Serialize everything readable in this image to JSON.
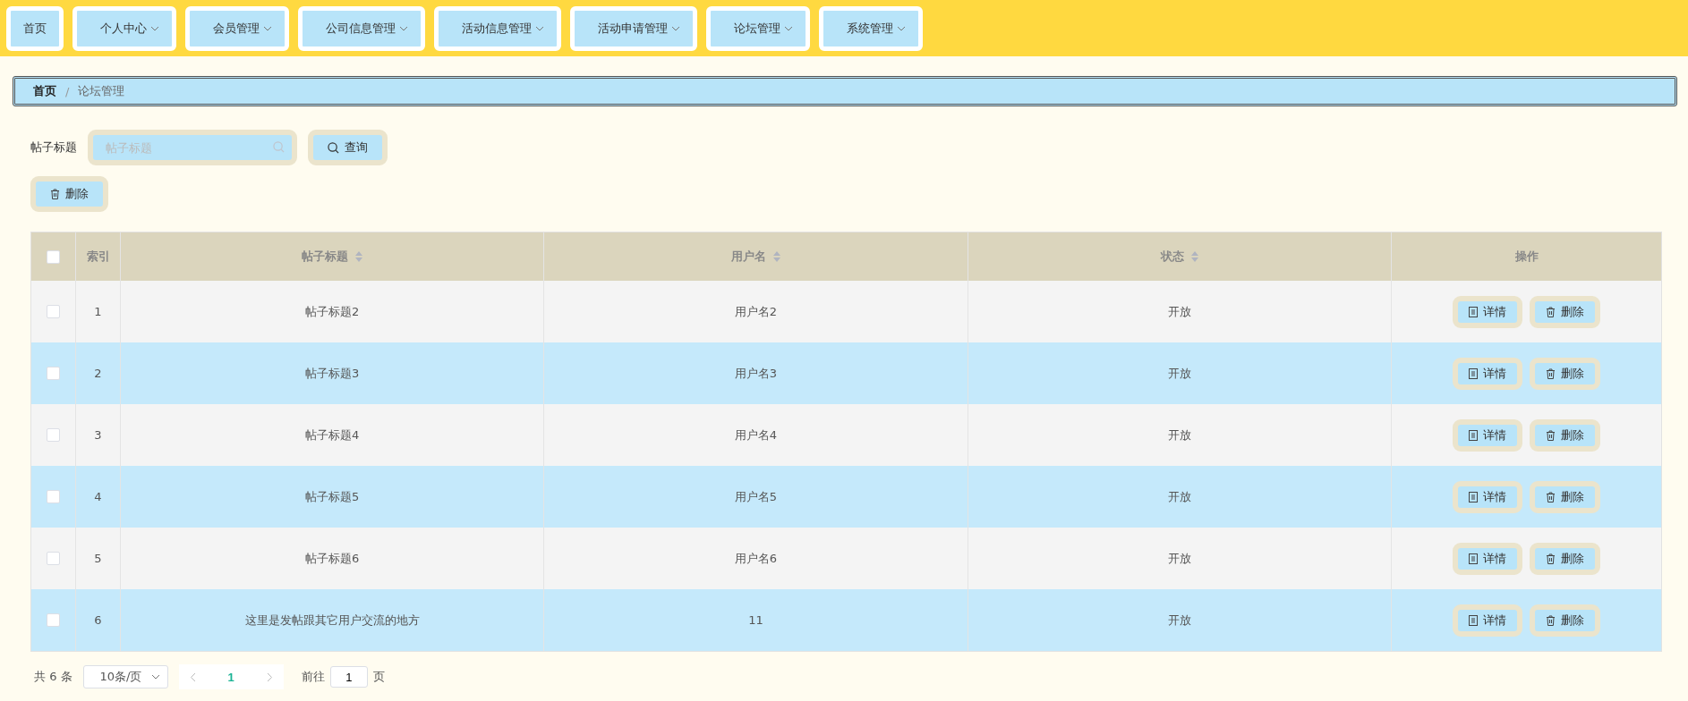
{
  "nav": [
    {
      "label": "首页",
      "dropdown": false
    },
    {
      "label": "个人中心",
      "dropdown": true
    },
    {
      "label": "会员管理",
      "dropdown": true
    },
    {
      "label": "公司信息管理",
      "dropdown": true
    },
    {
      "label": "活动信息管理",
      "dropdown": true
    },
    {
      "label": "活动申请管理",
      "dropdown": true
    },
    {
      "label": "论坛管理",
      "dropdown": true
    },
    {
      "label": "系统管理",
      "dropdown": true
    }
  ],
  "breadcrumb": [
    "首页",
    "论坛管理"
  ],
  "breadcrumb_separator": "/",
  "search": {
    "label": "帖子标题",
    "placeholder": "帖子标题",
    "button": "查询"
  },
  "bulk_delete": "删除",
  "table": {
    "select_all_checked": false,
    "columns": [
      {
        "label": "索引",
        "sortable": false
      },
      {
        "label": "帖子标题",
        "sortable": true
      },
      {
        "label": "用户名",
        "sortable": true
      },
      {
        "label": "状态",
        "sortable": true
      },
      {
        "label": "操作",
        "sortable": false
      }
    ],
    "rows": [
      {
        "checked": false,
        "index": "1",
        "title": "帖子标题2",
        "user": "用户名2",
        "status": "开放",
        "actions": [
          "详情",
          "删除"
        ]
      },
      {
        "checked": false,
        "index": "2",
        "title": "帖子标题3",
        "user": "用户名3",
        "status": "开放",
        "actions": [
          "详情",
          "删除"
        ]
      },
      {
        "checked": false,
        "index": "3",
        "title": "帖子标题4",
        "user": "用户名4",
        "status": "开放",
        "actions": [
          "详情",
          "删除"
        ]
      },
      {
        "checked": false,
        "index": "4",
        "title": "帖子标题5",
        "user": "用户名5",
        "status": "开放",
        "actions": [
          "详情",
          "删除"
        ]
      },
      {
        "checked": false,
        "index": "5",
        "title": "帖子标题6",
        "user": "用户名6",
        "status": "开放",
        "actions": [
          "详情",
          "删除"
        ]
      },
      {
        "checked": false,
        "index": "6",
        "title": "这里是发帖跟其它用户交流的地方",
        "user": "11",
        "status": "开放",
        "actions": [
          "详情",
          "删除"
        ]
      }
    ]
  },
  "pagination": {
    "total": "共 6 条",
    "page_size": "10条/页",
    "pages": [
      {
        "label": "1",
        "selected": true
      }
    ],
    "goto_label": "前往",
    "goto_value": "1",
    "page_suffix": "页"
  }
}
